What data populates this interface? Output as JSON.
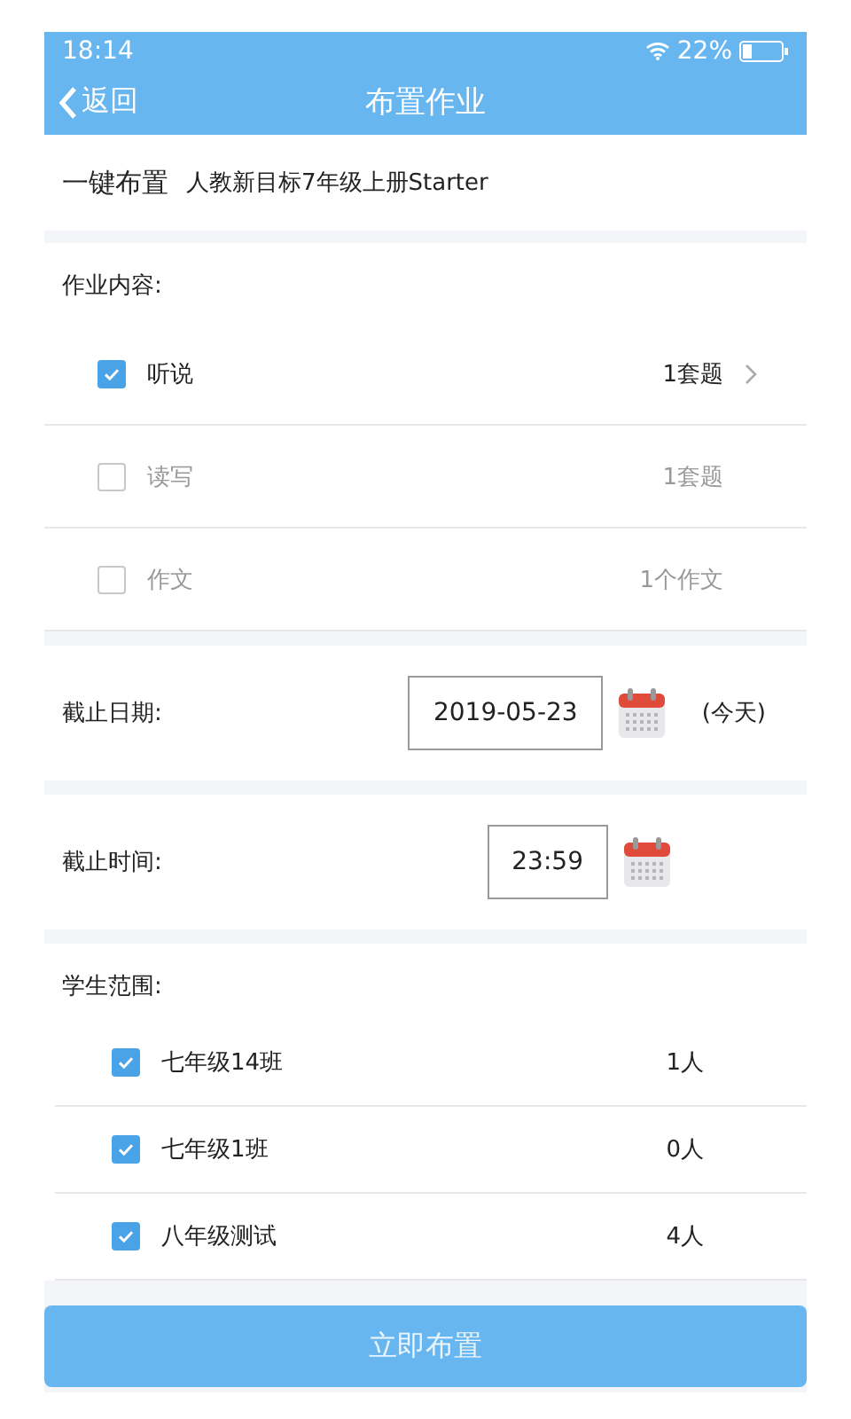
{
  "status_bar": {
    "time": "18:14",
    "battery": "22%"
  },
  "nav": {
    "back": "返回",
    "title": "布置作业"
  },
  "preset": {
    "label": "一键布置",
    "book": "人教新目标7年级上册Starter"
  },
  "content": {
    "heading": "作业内容:",
    "items": [
      {
        "name": "听说",
        "count": "1套题",
        "checked": true
      },
      {
        "name": "读写",
        "count": "1套题",
        "checked": false
      },
      {
        "name": "作文",
        "count": "1个作文",
        "checked": false
      }
    ]
  },
  "deadline_date": {
    "label": "截止日期:",
    "value": "2019-05-23",
    "note": "(今天)"
  },
  "deadline_time": {
    "label": "截止时间:",
    "value": "23:59"
  },
  "students": {
    "heading": "学生范围:",
    "classes": [
      {
        "name": "七年级14班",
        "count": "1人",
        "checked": true
      },
      {
        "name": "七年级1班",
        "count": "0人",
        "checked": true
      },
      {
        "name": "八年级测试",
        "count": "4人",
        "checked": true
      }
    ]
  },
  "submit": "立即布置"
}
